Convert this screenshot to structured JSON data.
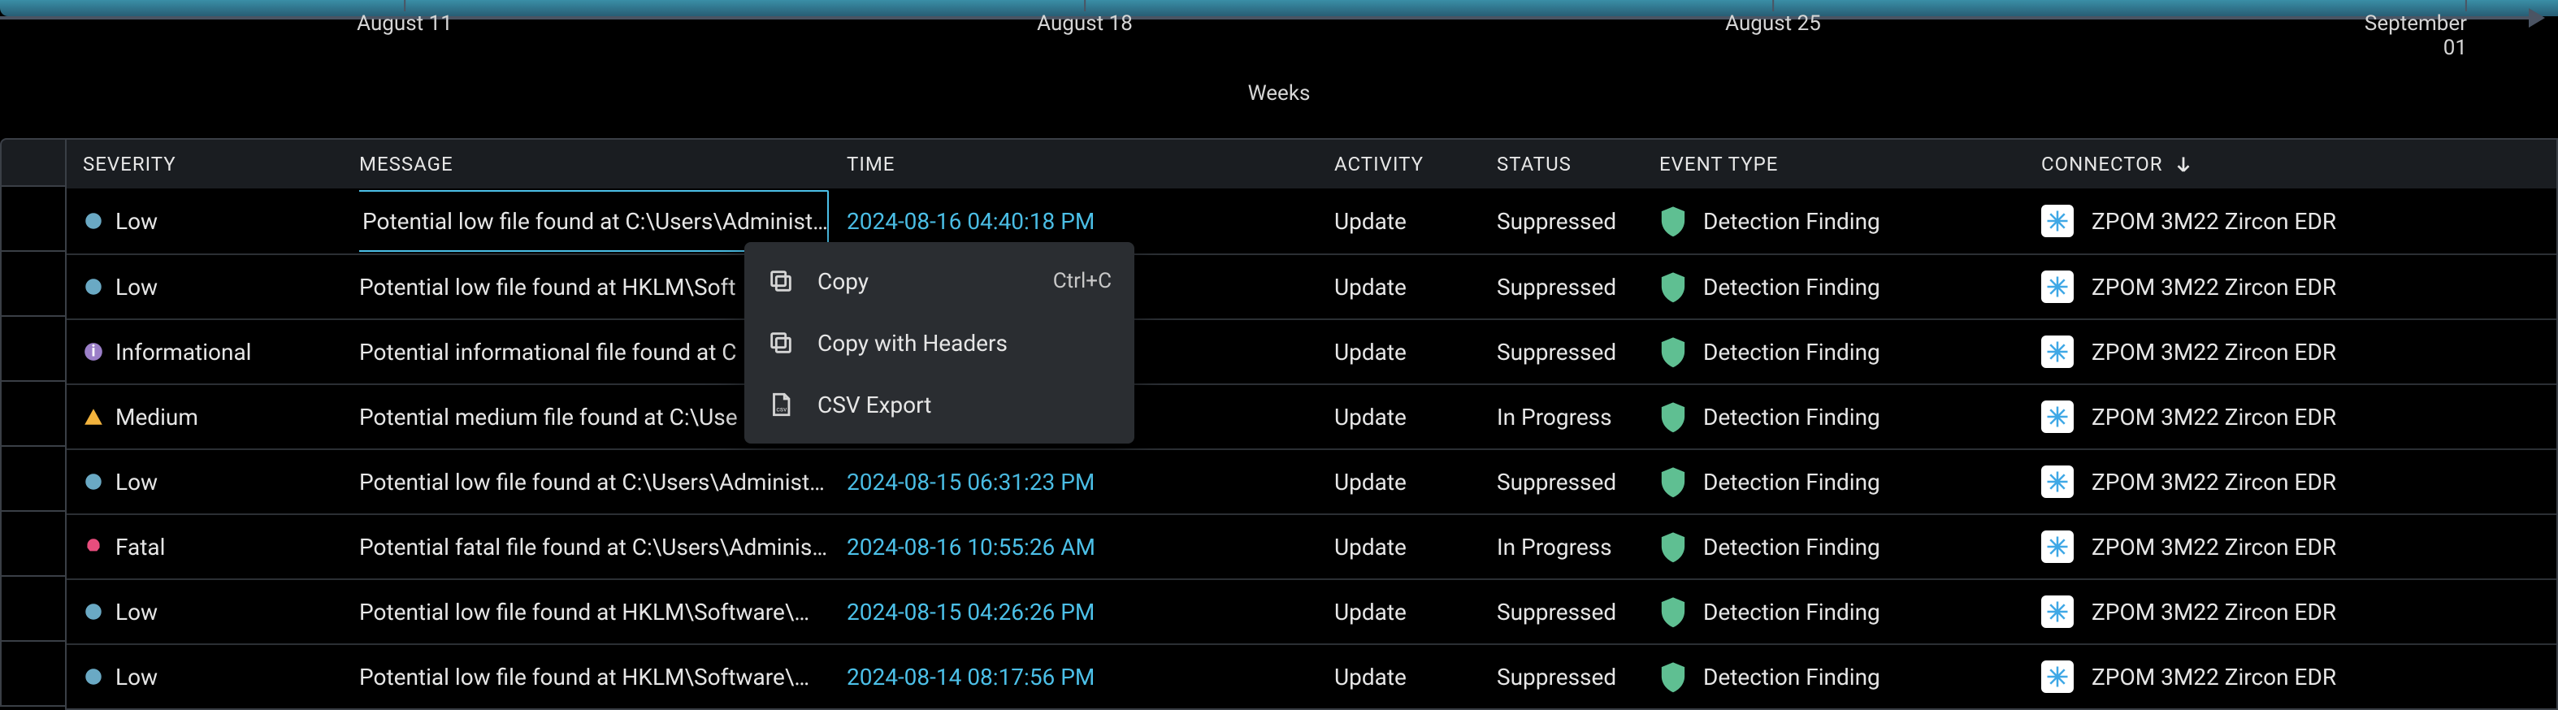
{
  "timeline": {
    "ticks": [
      "August 11",
      "August 18",
      "August 25",
      "September 01"
    ],
    "axis_label": "Weeks"
  },
  "columns": {
    "severity": "Severity",
    "message": "Message",
    "time": "Time",
    "activity": "Activity",
    "status": "Status",
    "event_type": "Event Type",
    "connector": "Connector"
  },
  "sort": {
    "column": "connector",
    "direction": "desc"
  },
  "rows": [
    {
      "severity": "Low",
      "sev_kind": "low",
      "message": "Potential low file found at C:\\Users\\Administ…",
      "time": "2024-08-16 04:40:18 PM",
      "activity": "Update",
      "status": "Suppressed",
      "event_type": "Detection Finding",
      "connector": "ZPOM 3M22 Zircon EDR"
    },
    {
      "severity": "Low",
      "sev_kind": "low",
      "message": "Potential low file found at HKLM\\Soft",
      "time": "",
      "activity": "Update",
      "status": "Suppressed",
      "event_type": "Detection Finding",
      "connector": "ZPOM 3M22 Zircon EDR"
    },
    {
      "severity": "Informational",
      "sev_kind": "info",
      "message": "Potential informational file found at C",
      "time": "",
      "activity": "Update",
      "status": "Suppressed",
      "event_type": "Detection Finding",
      "connector": "ZPOM 3M22 Zircon EDR"
    },
    {
      "severity": "Medium",
      "sev_kind": "med",
      "message": "Potential medium file found at C:\\Use",
      "time": "",
      "activity": "Update",
      "status": "In Progress",
      "event_type": "Detection Finding",
      "connector": "ZPOM 3M22 Zircon EDR"
    },
    {
      "severity": "Low",
      "sev_kind": "low",
      "message": "Potential low file found at C:\\Users\\Administ…",
      "time": "2024-08-15 06:31:23 PM",
      "activity": "Update",
      "status": "Suppressed",
      "event_type": "Detection Finding",
      "connector": "ZPOM 3M22 Zircon EDR"
    },
    {
      "severity": "Fatal",
      "sev_kind": "fatal",
      "message": "Potential fatal file found at C:\\Users\\Adminis…",
      "time": "2024-08-16 10:55:26 AM",
      "activity": "Update",
      "status": "In Progress",
      "event_type": "Detection Finding",
      "connector": "ZPOM 3M22 Zircon EDR"
    },
    {
      "severity": "Low",
      "sev_kind": "low",
      "message": "Potential low file found at HKLM\\Software\\…",
      "time": "2024-08-15 04:26:26 PM",
      "activity": "Update",
      "status": "Suppressed",
      "event_type": "Detection Finding",
      "connector": "ZPOM 3M22 Zircon EDR"
    },
    {
      "severity": "Low",
      "sev_kind": "low",
      "message": "Potential low file found at HKLM\\Software\\…",
      "time": "2024-08-14 08:17:56 PM",
      "activity": "Update",
      "status": "Suppressed",
      "event_type": "Detection Finding",
      "connector": "ZPOM 3M22 Zircon EDR"
    }
  ],
  "active_cell": {
    "row": 0,
    "col": "message"
  },
  "context_menu": {
    "items": [
      {
        "icon": "copy",
        "label": "Copy",
        "accel": "Ctrl+C"
      },
      {
        "icon": "copy",
        "label": "Copy with Headers",
        "accel": ""
      },
      {
        "icon": "file-csv",
        "label": "CSV Export",
        "accel": ""
      }
    ]
  }
}
